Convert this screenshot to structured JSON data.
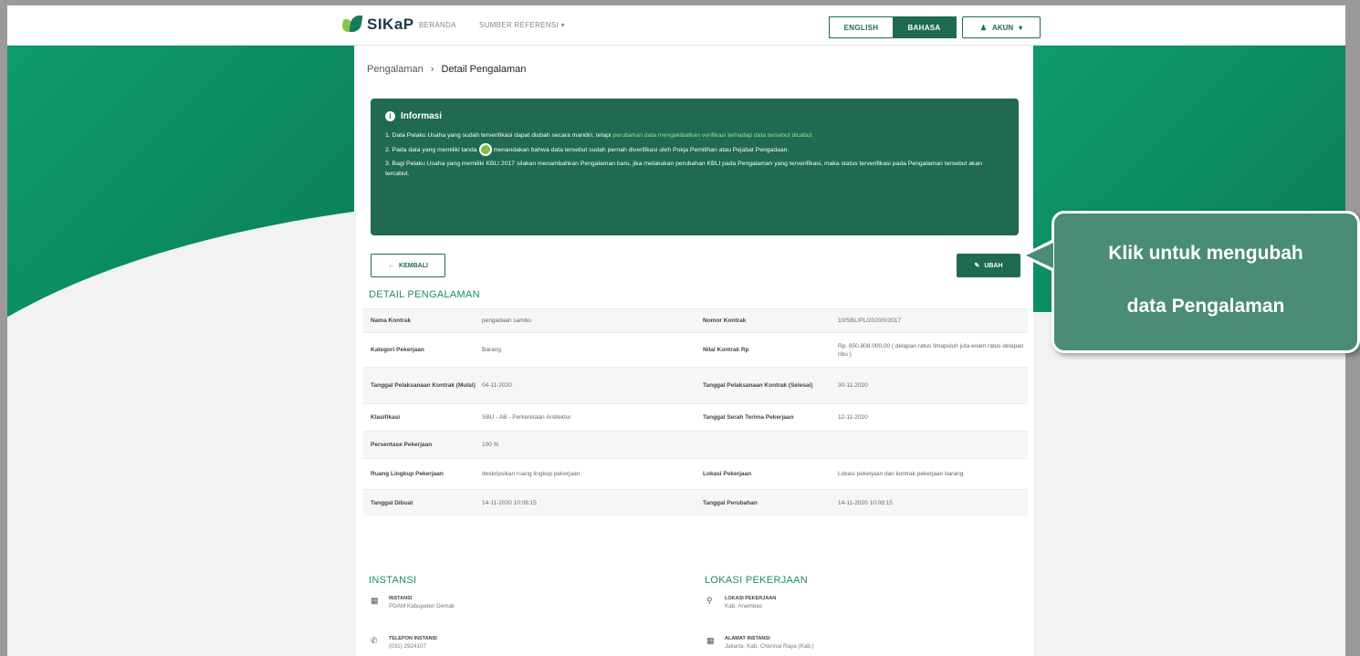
{
  "app": {
    "logo_text": "SIKaP"
  },
  "nav": {
    "beranda": "BERANDA",
    "sumber": "SUMBER REFERENSI ▾"
  },
  "lang": {
    "english": "ENGLISH",
    "bahasa": "BAHASA"
  },
  "account": {
    "label": "AKUN",
    "icon": "user-icon"
  },
  "breadcrumb": {
    "parent": "Pengalaman",
    "separator": "›",
    "current": "Detail Pengalaman"
  },
  "info": {
    "title": "Informasi",
    "line1_a": "1. Data Pelaku Usaha yang sudah terverifikasi dapat diubah secara mandiri, tetapi ",
    "line1_b": "perubahan data mengakibatkan verifikasi terhadap data tersebut dicabut.",
    "line2_a": "2. Pada data yang memiliki tanda",
    "line2_b": "menandakan bahwa data tersebut sudah pernah diverifikasi oleh Pokja Pemilihan atau Pejabat Pengadaan.",
    "line3": "3. Bagi Pelaku Usaha yang memiliki KBLI 2017 silakan menambahkan Pengalaman baru, jika melakukan perubahan KBLI pada Pengalaman yang terverifikasi, maka status terverifikasi pada Pengalaman tersebut akan tercabut."
  },
  "buttons": {
    "kembali": "KEMBALI",
    "ubah": "UBAH"
  },
  "detail": {
    "title": "DETAIL PENGALAMAN",
    "rows": [
      {
        "k1": "Nama Kontrak",
        "v1": "pengadaan sambo",
        "k2": "Nomor Kontrak",
        "v2": "10/SBL/PL/2020/II/2017"
      },
      {
        "k1": "Kategori Pekerjaan",
        "v1": "Barang",
        "k2": "Nilai Kontrak Rp",
        "v2": "Rp. 850.808.000,00 ( delapan ratus limapuluh juta enam ratus delapan ribu )"
      },
      {
        "k1": "Tanggal Pelaksanaan Kontrak (Mulai)",
        "v1": "04-11-2020",
        "k2": "Tanggal Pelaksanaan Kontrak (Selesai)",
        "v2": "30-11-2020"
      },
      {
        "k1": "Klasifikasi",
        "v1": "SBU - AB - Perkeretaan Arsitektur",
        "k2": "Tanggal Serah Terima Pekerjaan",
        "v2": "12-11-2020"
      },
      {
        "k1": "Persentase Pekerjaan",
        "v1": "100 %",
        "k2": "",
        "v2": ""
      },
      {
        "k1": "Ruang Lingkup Pekerjaan",
        "v1": "deskripsikan ruang lingkup pekerjaan",
        "k2": "Lokasi Pekerjaan",
        "v2": "Lokasi pekerjaan dan kontrak pekerjaan barang"
      },
      {
        "k1": "Tanggal Dibuat",
        "v1": "14-11-2020 10:08:15",
        "k2": "Tanggal Perubahan",
        "v2": "14-11-2020 10:08:15"
      }
    ]
  },
  "instansi": {
    "title": "INSTANSI",
    "items": [
      {
        "icon": "building-icon",
        "label": "INSTANSI",
        "value": "PDAM Kabupaten Demak"
      },
      {
        "icon": "phone-icon",
        "label": "TELEPON INSTANSI",
        "value": "(031) 2924107"
      }
    ]
  },
  "lokasi": {
    "title": "LOKASI PEKERJAAN",
    "items": [
      {
        "icon": "pin-icon",
        "label": "LOKASI PEKERJAAN",
        "value": "Kab. Anambas"
      },
      {
        "icon": "map-icon",
        "label": "ALAMAT INSTANSI",
        "value": "Jakarta, Kab. Chennai Raya (Kab.)"
      }
    ]
  },
  "callout": {
    "line1": "Klik untuk mengubah",
    "line2": "data Pengalaman"
  },
  "colors": {
    "primary": "#1e6b4f",
    "accent": "#0f9b6c",
    "callout": "#4a8c76"
  }
}
